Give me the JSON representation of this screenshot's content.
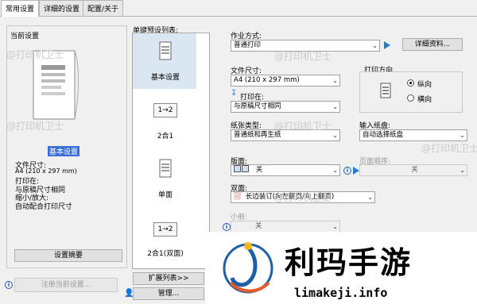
{
  "tabs": [
    "常用设置",
    "详细的设置",
    "配置/关于"
  ],
  "current_settings": {
    "heading": "当前设置",
    "preset_name": "基本设置",
    "details": [
      "文件尺寸:",
      "  A4 (210 x 297 mm)",
      "打印在:",
      "  与原稿尺寸相同",
      "缩小/放大:",
      "  自动配合打印尺寸"
    ],
    "summary_button": "设置摘要",
    "register_button": "注册当前设置..."
  },
  "preset_list": {
    "heading": "单键预设列表:",
    "items": [
      {
        "label": "基本设置",
        "thumb": "page"
      },
      {
        "label": "2合1",
        "thumb": "1→2"
      },
      {
        "label": "单面",
        "thumb": "page"
      },
      {
        "label": "2合1(双面)",
        "thumb": "1→2"
      }
    ],
    "expand_button": "扩展列表>>",
    "manage_button": "管理..."
  },
  "job": {
    "label": "作业方式:",
    "value": "普通打印",
    "details_button": "详细资料..."
  },
  "page_size": {
    "label": "文件尺寸:",
    "value": "A4 (210 x 297 mm)"
  },
  "print_on": {
    "label": "打印在:",
    "value": "与原稿尺寸相同"
  },
  "orientation": {
    "heading": "打印方向",
    "portrait": "纵向",
    "landscape": "横向"
  },
  "paper_type": {
    "label": "纸张类型:",
    "value": "普通纸和再生纸"
  },
  "paper_source": {
    "label": "输入纸盘:",
    "value": "自动选择纸盘"
  },
  "layout": {
    "label": "版面:",
    "value": "关"
  },
  "page_order": {
    "label": "页面顺序:",
    "value": "关"
  },
  "duplex": {
    "label": "双面:",
    "value": "长边装订(向左翻页/向上翻页)"
  },
  "booklet": {
    "label": "小册:",
    "value": "关"
  },
  "watermark_text": "@打印机卫士",
  "logo": {
    "name": "利玛手游",
    "url": "limakeji.info"
  }
}
